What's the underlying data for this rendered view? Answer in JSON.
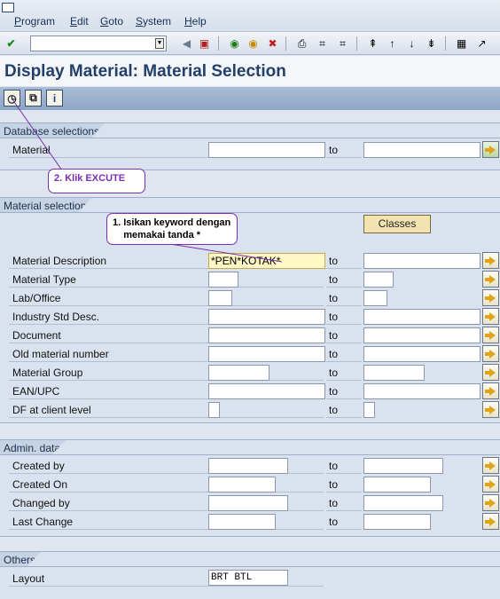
{
  "menu": {
    "items": [
      "Program",
      "Edit",
      "Goto",
      "System",
      "Help"
    ]
  },
  "toolbar": {
    "command_value": ""
  },
  "title": "Display Material: Material Selection",
  "database_selections": {
    "header": "Database selections",
    "rows": [
      {
        "label": "Material",
        "to": "to",
        "low": "",
        "high": ""
      }
    ]
  },
  "callouts": {
    "execute": "2. Klik EXCUTE",
    "keyword": "1. Isikan keyword dengan\n    memakai tanda *"
  },
  "material_selection": {
    "header": "Material selection",
    "classes_button": "Classes",
    "rows": [
      {
        "label": "Material Description",
        "to": "to",
        "low": "*PEN*KOTAK*",
        "high": ""
      },
      {
        "label": "Material Type",
        "to": "to",
        "low": "",
        "high": ""
      },
      {
        "label": "Lab/Office",
        "to": "to",
        "low": "",
        "high": ""
      },
      {
        "label": "Industry Std Desc.",
        "to": "to",
        "low": "",
        "high": ""
      },
      {
        "label": "Document",
        "to": "to",
        "low": "",
        "high": ""
      },
      {
        "label": "Old material number",
        "to": "to",
        "low": "",
        "high": ""
      },
      {
        "label": "Material Group",
        "to": "to",
        "low": "",
        "high": ""
      },
      {
        "label": "EAN/UPC",
        "to": "to",
        "low": "",
        "high": ""
      },
      {
        "label": "DF at client level",
        "to": "to",
        "low": "",
        "high": ""
      }
    ]
  },
  "admin_data": {
    "header": "Admin. data",
    "rows": [
      {
        "label": "Created by",
        "to": "to",
        "low": "",
        "high": ""
      },
      {
        "label": "Created On",
        "to": "to",
        "low": "",
        "high": ""
      },
      {
        "label": "Changed by",
        "to": "to",
        "low": "",
        "high": ""
      },
      {
        "label": "Last Change",
        "to": "to",
        "low": "",
        "high": ""
      }
    ]
  },
  "others": {
    "header": "Others",
    "layout_label": "Layout",
    "layout_value": "BRT BTL"
  },
  "colors": {
    "title": "#23406b",
    "callout_border": "#7a2fb0",
    "active_field": "#fff7c4"
  }
}
